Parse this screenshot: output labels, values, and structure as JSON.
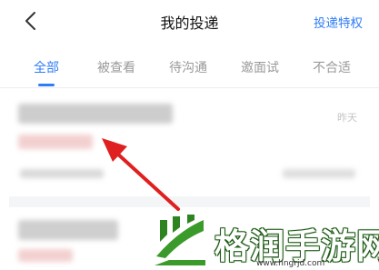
{
  "header": {
    "back_icon": "chevron-left-icon",
    "title": "我的投递",
    "perk_link": "投递特权"
  },
  "tabs": [
    {
      "label": "全部",
      "active": true
    },
    {
      "label": "被查看",
      "active": false
    },
    {
      "label": "待沟通",
      "active": false
    },
    {
      "label": "邀面试",
      "active": false
    },
    {
      "label": "不合适",
      "active": false
    }
  ],
  "list": {
    "items": [
      {
        "time": "昨天",
        "blurred": true
      },
      {
        "blurred": true
      }
    ]
  },
  "annotation": {
    "arrow_color": "#e02020"
  },
  "watermark": {
    "text": "格润手游网",
    "url": "www.hngrjd.com",
    "logo_color": "#3a9a2a"
  },
  "colors": {
    "accent": "#2f7df6",
    "tab_inactive": "#9a9a9a"
  }
}
